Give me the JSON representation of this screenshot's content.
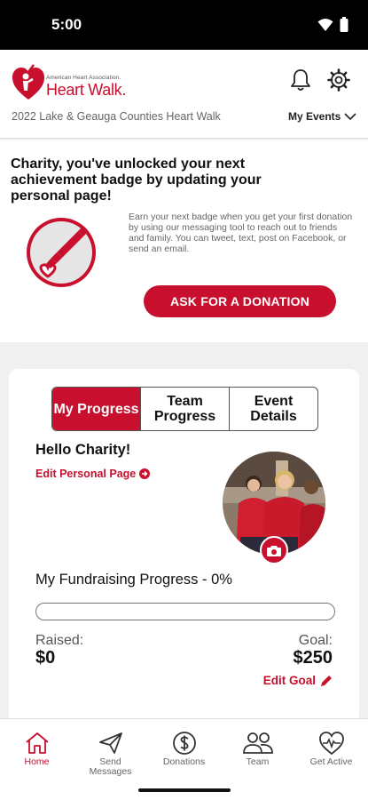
{
  "status_bar": {
    "time": "5:00",
    "icons": [
      "wifi-icon",
      "battery-icon"
    ]
  },
  "header": {
    "organization": "American Heart Association.",
    "app_name": "Heart Walk.",
    "event_name": "2022 Lake & Geauga Counties Heart Walk",
    "my_events_label": "My Events",
    "icons": [
      "bell-icon",
      "settings-icon",
      "chevron-down-icon"
    ]
  },
  "badge": {
    "title": "Charity, you've unlocked your next achievement badge by updating your personal page!",
    "description": "Earn your next badge when you get your first donation by using our messaging tool to reach out to friends and family. You can tweet, text, post on Facebook, or send an email.",
    "button_label": "ASK FOR A DONATION",
    "icon": "pencil-heart-badge-icon"
  },
  "progress_card": {
    "tabs": [
      {
        "label": "My Progress",
        "active": true
      },
      {
        "label": "Team Progress",
        "active": false
      },
      {
        "label": "Event Details",
        "active": false
      }
    ],
    "greeting": "Hello Charity!",
    "edit_page_label": "Edit Personal Page",
    "fundraising_label": "My Fundraising Progress - 0%",
    "progress_fraction": 0,
    "raised_label": "Raised:",
    "raised_value": "$0",
    "goal_label": "Goal:",
    "goal_value": "$250",
    "edit_goal_label": "Edit Goal",
    "icons": [
      "arrow-circle-right-icon",
      "camera-icon",
      "pencil-icon"
    ]
  },
  "bottom_nav": [
    {
      "label": "Home",
      "icon": "home-icon",
      "active": true
    },
    {
      "label": "Send Messages",
      "icon": "paper-plane-icon",
      "active": false
    },
    {
      "label": "Donations",
      "icon": "dollar-circle-icon",
      "active": false
    },
    {
      "label": "Team",
      "icon": "team-icon",
      "active": false
    },
    {
      "label": "Get Active",
      "icon": "heartbeat-icon",
      "active": false
    }
  ],
  "colors": {
    "brand_red": "#c8102e",
    "background": "#f0f0f0",
    "text": "#111111",
    "muted": "#666666"
  }
}
